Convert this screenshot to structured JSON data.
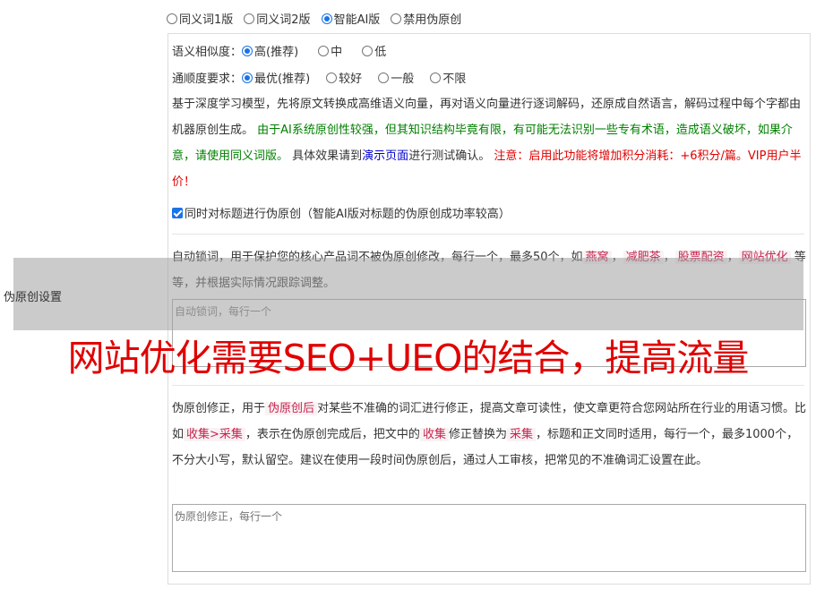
{
  "mode_options": [
    {
      "label": "同义词1版",
      "selected": false
    },
    {
      "label": "同义词2版",
      "selected": false
    },
    {
      "label": "智能AI版",
      "selected": true
    },
    {
      "label": "禁用伪原创",
      "selected": false
    }
  ],
  "similarity": {
    "label": "语义相似度：",
    "options": [
      {
        "label": "高(推荐)",
        "selected": true
      },
      {
        "label": "中",
        "selected": false
      },
      {
        "label": "低",
        "selected": false
      }
    ]
  },
  "fluency": {
    "label": "通顺度要求：",
    "options": [
      {
        "label": "最优(推荐)",
        "selected": true
      },
      {
        "label": "较好",
        "selected": false
      },
      {
        "label": "一般",
        "selected": false
      },
      {
        "label": "不限",
        "selected": false
      }
    ]
  },
  "description": {
    "part1": "基于深度学习模型，先将原文转换成高维语义向量，再对语义向量进行逐词解码，还原成自然语言，解码过程中每个字都由机器原创生成。",
    "green": "由于AI系统原创性较强，但其知识结构毕竟有限，有可能无法识别一些专有术语，造成语义破坏，如果介意，请使用同义词版。",
    "part2": "具体效果请到",
    "link": "演示页面",
    "part3": "进行测试确认。",
    "red": "注意：启用此功能将增加积分消耗：+6积分/篇。VIP用户半价！"
  },
  "title_checkbox": {
    "label": "同时对标题进行伪原创（智能AI版对标题的伪原创成功率较高）",
    "checked": true
  },
  "lock_words": {
    "part1": "自动锁词，用于保护您的核心产品词不被伪原创修改，每行一个，最多50个，如",
    "tags": [
      "燕窝",
      "减肥茶",
      "股票配资",
      "网站优化"
    ],
    "part2": "等等，并根据实际情况跟踪调整。",
    "placeholder": "自动锁词，每行一个"
  },
  "correction": {
    "part1": "伪原创修正，用于",
    "tag1": "伪原创后",
    "part2": "对某些不准确的词汇进行修正，提高文章可读性，使文章更符合您网站所在行业的用语习惯。比如",
    "tag2": "收集>采集",
    "part3": "，表示在伪原创完成后，把文中的",
    "tag3": "收集",
    "part4": "修正替换为",
    "tag4": "采集",
    "part5": "，标题和正文同时适用，每行一个，最多1000个，不分大小写，默认留空。建议在使用一段时间伪原创后，通过人工审核，把常见的不准确词汇设置在此。",
    "placeholder": "伪原创修正，每行一个"
  },
  "side_label": "伪原创设置",
  "watermark": "网站优化需要SEO+UEO的结合，提高流量"
}
